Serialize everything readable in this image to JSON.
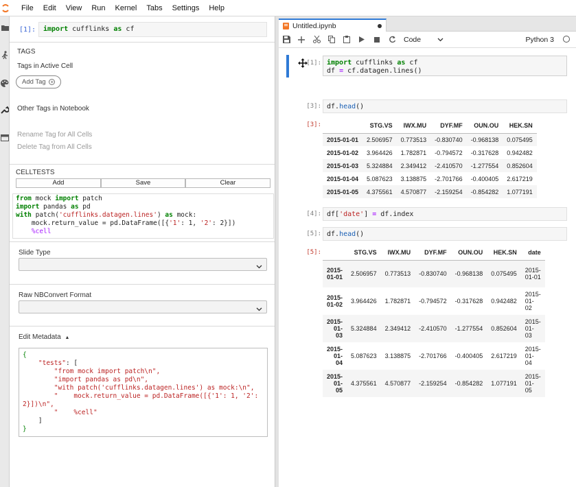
{
  "menubar": {
    "items": [
      "File",
      "Edit",
      "View",
      "Run",
      "Kernel",
      "Tabs",
      "Settings",
      "Help"
    ]
  },
  "activity_icons": [
    "folder-icon",
    "running-icon",
    "palette-icon",
    "wrench-icon",
    "tabs-icon"
  ],
  "sidebar": {
    "active_cell": {
      "prompt": "[1]:",
      "code_kw": "import",
      "code_mod": " cufflinks ",
      "code_as": "as",
      "code_alias": " cf"
    },
    "tags": {
      "title": "TAGS",
      "active_label": "Tags in Active Cell",
      "add_tag": "Add Tag",
      "other_label": "Other Tags in Notebook",
      "rename": "Rename Tag for All Cells",
      "delete": "Delete Tag from All Cells"
    },
    "celltests": {
      "title": "CELLTESTS",
      "add": "Add",
      "save": "Save",
      "clear": "Clear"
    },
    "slide_type": {
      "label": "Slide Type",
      "value": ""
    },
    "nbconvert": {
      "label": "Raw NBConvert Format",
      "value": ""
    },
    "metadata": {
      "label": "Edit Metadata"
    }
  },
  "notebook": {
    "tab_title": "Untitled.ipynb",
    "cell_type": "Code",
    "kernel": "Python 3",
    "cells": {
      "c1_prompt": "[1]:",
      "c3_prompt": "[3]:",
      "c3_out_prompt": "[3]:",
      "c4_prompt": "[4]:",
      "c5_prompt": "[5]:",
      "c5_out_prompt": "[5]:"
    },
    "table1": {
      "columns": [
        "",
        "STG.VS",
        "IWX.MU",
        "DYF.MF",
        "OUN.OU",
        "HEK.SN"
      ],
      "rows": [
        [
          "2015-01-01",
          "2.506957",
          "0.773513",
          "-0.830740",
          "-0.968138",
          "0.075495"
        ],
        [
          "2015-01-02",
          "3.964426",
          "1.782871",
          "-0.794572",
          "-0.317628",
          "0.942482"
        ],
        [
          "2015-01-03",
          "5.324884",
          "2.349412",
          "-2.410570",
          "-1.277554",
          "0.852604"
        ],
        [
          "2015-01-04",
          "5.087623",
          "3.138875",
          "-2.701766",
          "-0.400405",
          "2.617219"
        ],
        [
          "2015-01-05",
          "4.375561",
          "4.570877",
          "-2.159254",
          "-0.854282",
          "1.077191"
        ]
      ]
    },
    "table2": {
      "columns": [
        "",
        "STG.VS",
        "IWX.MU",
        "DYF.MF",
        "OUN.OU",
        "HEK.SN",
        "date"
      ],
      "rows": [
        [
          [
            "2015-",
            "01-01"
          ],
          "2.506957",
          "0.773513",
          "-0.830740",
          "-0.968138",
          "0.075495",
          [
            "2015-",
            "01-01"
          ]
        ],
        [
          [
            "2015-",
            "01-02"
          ],
          "3.964426",
          "1.782871",
          "-0.794572",
          "-0.317628",
          "0.942482",
          [
            "2015-",
            "01-",
            "02"
          ]
        ],
        [
          [
            "2015-",
            "01-",
            "03"
          ],
          "5.324884",
          "2.349412",
          "-2.410570",
          "-1.277554",
          "0.852604",
          [
            "2015-",
            "01-",
            "03"
          ]
        ],
        [
          [
            "2015-",
            "01-",
            "04"
          ],
          "5.087623",
          "3.138875",
          "-2.701766",
          "-0.400405",
          "2.617219",
          [
            "2015-",
            "01-",
            "04"
          ]
        ],
        [
          [
            "2015-",
            "01-",
            "05"
          ],
          "4.375561",
          "4.570877",
          "-2.159254",
          "-0.854282",
          "1.077191",
          [
            "2015-",
            "01-",
            "05"
          ]
        ]
      ]
    }
  }
}
